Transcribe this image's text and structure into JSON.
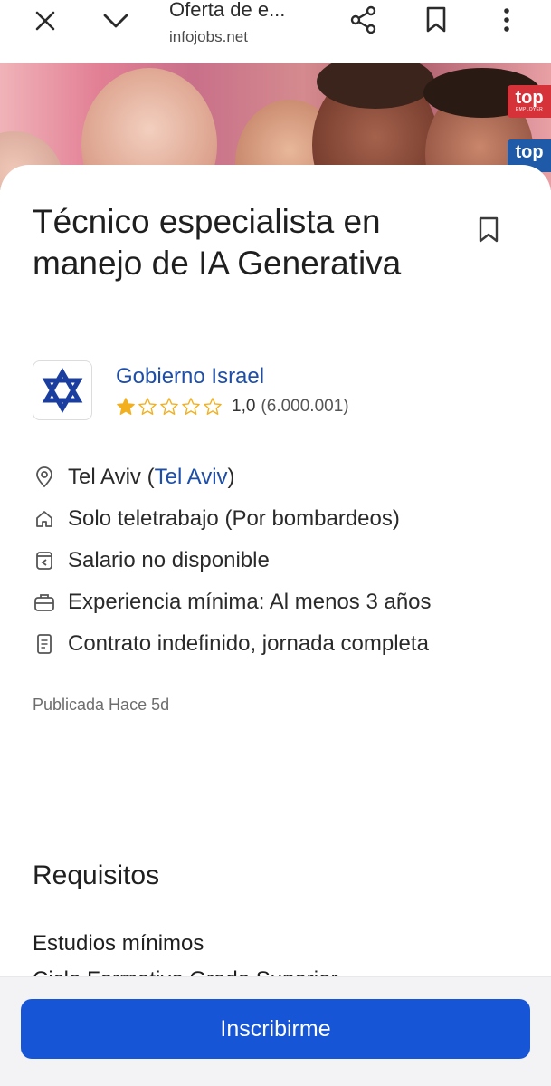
{
  "browser": {
    "title": "Oferta de e...",
    "url": "infojobs.net"
  },
  "hero": {
    "badge1": "top",
    "badge1_sub": "EMPLOYER",
    "badge2": "top"
  },
  "job": {
    "title": "Técnico especialista en manejo de IA Generativa",
    "company": "Gobierno Israel",
    "rating_value": "1,0",
    "rating_count": "(6.000.001)",
    "rating_stars": 1,
    "rating_max": 5
  },
  "details": {
    "location_city": "Tel Aviv",
    "location_region": "Tel Aviv",
    "remote": "Solo teletrabajo (Por bombardeos)",
    "salary": "Salario no disponible",
    "experience": "Experiencia mínima: Al menos 3 años",
    "contract": "Contrato indefinido, jornada completa"
  },
  "published": "Publicada Hace 5d",
  "requirements": {
    "section_title": "Requisitos",
    "studies_label": "Estudios mínimos",
    "studies_value": "Ciclo Formativo Grado Superior"
  },
  "cta": {
    "apply_label": "Inscribirme"
  },
  "colors": {
    "brand_blue": "#1656d6",
    "link_blue": "#1e4fa8",
    "star_gold": "#f2b01e"
  }
}
